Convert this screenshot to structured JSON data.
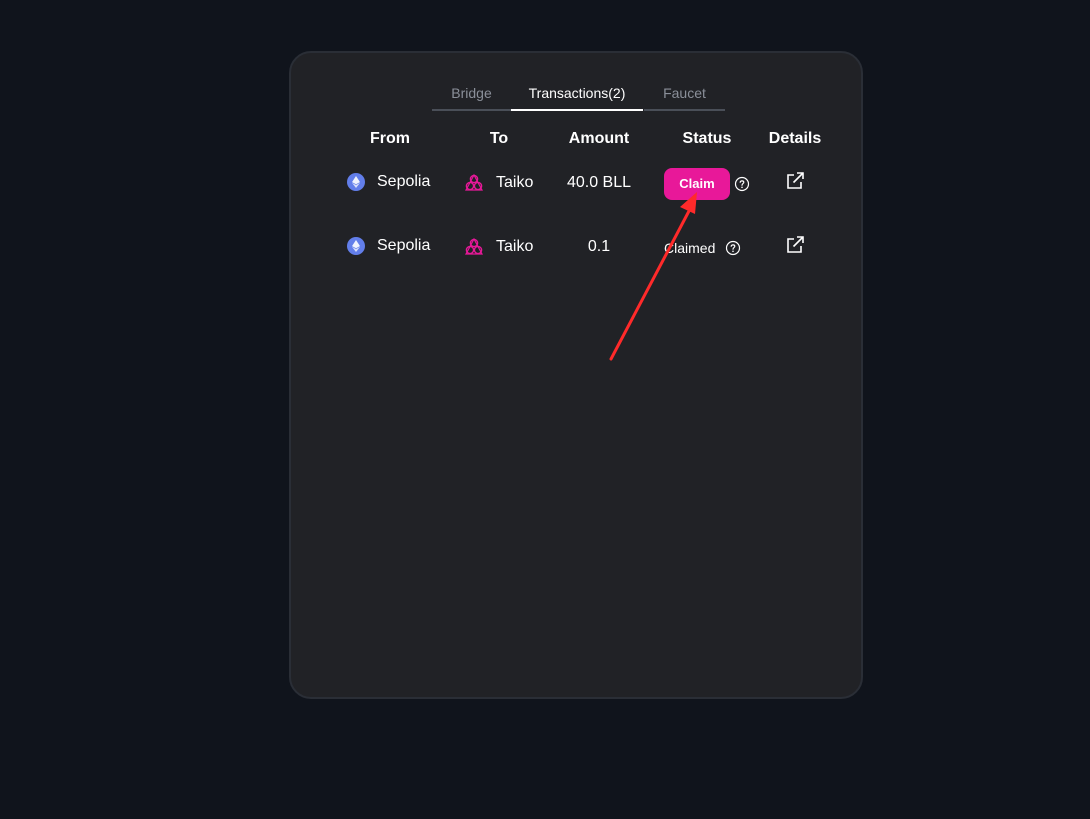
{
  "tabs": [
    {
      "label": "Bridge",
      "active": false
    },
    {
      "label": "Transactions(2)",
      "active": true
    },
    {
      "label": "Faucet",
      "active": false
    }
  ],
  "table": {
    "headers": [
      "From",
      "To",
      "Amount",
      "Status",
      "Details"
    ],
    "rows": [
      {
        "from": "Sepolia",
        "to": "Taiko",
        "amount": "40.0 BLL",
        "status": "Claim",
        "status_type": "button"
      },
      {
        "from": "Sepolia",
        "to": "Taiko",
        "amount": "0.1",
        "status": "Claimed",
        "status_type": "text"
      }
    ]
  },
  "icons": {
    "from_chain": "ethereum-icon",
    "to_chain": "taiko-icon",
    "status_help": "question-circle-icon",
    "details": "external-link-icon"
  },
  "colors": {
    "page_background": "#10141c",
    "card_background": "#212226",
    "accent": "#e81899",
    "ethereum": "#627eea",
    "annotation_arrow": "#ff2a2a"
  }
}
